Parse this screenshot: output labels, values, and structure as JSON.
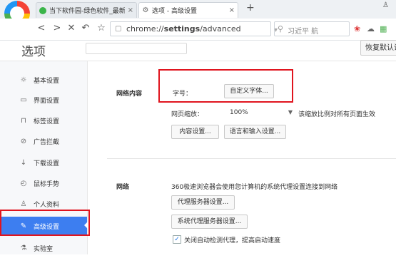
{
  "tabs": [
    {
      "title": "当下软件园-绿色软件_最新绿",
      "active": false
    },
    {
      "title": "选项 - 高级设置",
      "active": true
    }
  ],
  "new_tab_symbol": "+",
  "toolbar": {
    "url_prefix": "chrome://",
    "url_bold": "settings",
    "url_suffix": "/advanced",
    "search_text": "习近平 航"
  },
  "page": {
    "title": "选项",
    "restore_label": "恢复默认设"
  },
  "sidebar": {
    "items": [
      {
        "label": "基本设置",
        "icon": "gear-icon",
        "glyph": "☼",
        "active": false
      },
      {
        "label": "界面设置",
        "icon": "window-icon",
        "glyph": "▭",
        "active": false
      },
      {
        "label": "标签设置",
        "icon": "tab-icon",
        "glyph": "⊓",
        "active": false
      },
      {
        "label": "广告拦截",
        "icon": "block-icon",
        "glyph": "⊘",
        "active": false
      },
      {
        "label": "下载设置",
        "icon": "download-icon",
        "glyph": "↓",
        "active": false
      },
      {
        "label": "鼠标手势",
        "icon": "mouse-icon",
        "glyph": "◴",
        "active": false
      },
      {
        "label": "个人资料",
        "icon": "user-icon",
        "glyph": "♙",
        "active": false
      },
      {
        "label": "高级设置",
        "icon": "wrench-icon",
        "glyph": "✎",
        "active": true
      },
      {
        "label": "实验室",
        "icon": "lab-icon",
        "glyph": "⚗",
        "active": false
      }
    ]
  },
  "web_content": {
    "section_label": "网络内容",
    "font_size_label": "字号：",
    "custom_font_button": "自定义字体...",
    "zoom_label": "网页缩放：",
    "zoom_value": "100%",
    "zoom_hint": "该缩放比例对所有页面生效",
    "content_settings_button": "内容设置...",
    "language_button": "语言和输入设置..."
  },
  "network": {
    "section_label": "网络",
    "description": "360极速浏览器会使用您计算机的系统代理设置连接到网络",
    "proxy_button": "代理服务器设置...",
    "system_proxy_button": "系统代理服务器设置...",
    "auto_detect_label": "关闭自动检测代理，提高启动速度",
    "auto_detect_checked": true
  },
  "colors": {
    "accent": "#3d7ef0",
    "highlight_box": "#e0141e"
  }
}
